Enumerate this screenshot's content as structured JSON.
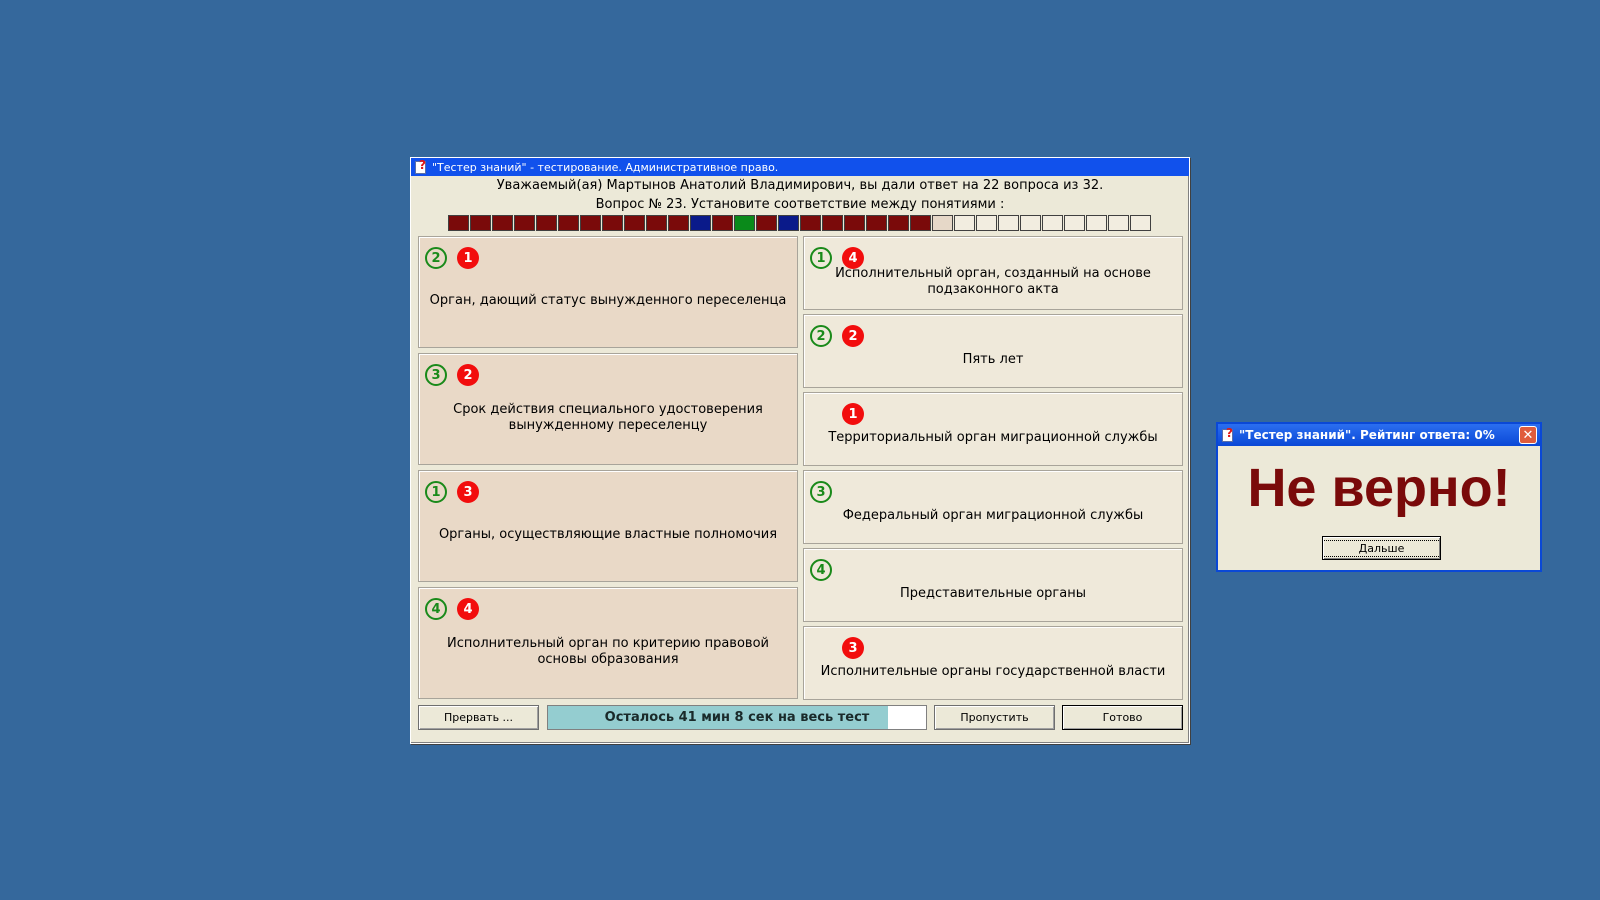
{
  "main_window": {
    "title": "\"Тестер знаний\" - тестирование. Административное право.",
    "greeting": "Уважаемый(ая) Мартынов Анатолий Владимирович, вы дали ответ на 22 вопроса из 32.",
    "question": "Вопрос № 23. Установите соответствие между понятиями :"
  },
  "progress": {
    "total": 32,
    "colors": {
      "wrong": "#7a0a0a",
      "skipped": "#0a1a8a",
      "correct": "#0a8a1a",
      "unanswered": "#f2ede0",
      "current": "#e6d8c8"
    },
    "cells": [
      "wrong",
      "wrong",
      "wrong",
      "wrong",
      "wrong",
      "wrong",
      "wrong",
      "wrong",
      "wrong",
      "wrong",
      "wrong",
      "skipped",
      "wrong",
      "correct",
      "wrong",
      "skipped",
      "wrong",
      "wrong",
      "wrong",
      "wrong",
      "wrong",
      "wrong",
      "current",
      "unanswered",
      "unanswered",
      "unanswered",
      "unanswered",
      "unanswered",
      "unanswered",
      "unanswered",
      "unanswered",
      "unanswered"
    ]
  },
  "left_items": [
    {
      "text": "Орган, дающий статус вынужденного переселенца",
      "green": "2",
      "red": "1"
    },
    {
      "text": "Срок действия специального удостоверения вынужденному переселенцу",
      "green": "3",
      "red": "2"
    },
    {
      "text": "Органы, осуществляющие властные полномочия",
      "green": "1",
      "red": "3"
    },
    {
      "text": "Исполнительный орган по критерию правовой основы образования",
      "green": "4",
      "red": "4"
    }
  ],
  "right_items": [
    {
      "text": "Исполнительный орган, созданный на основе подзаконного акта",
      "green": "1",
      "red": "4"
    },
    {
      "text": "Пять лет",
      "green": "2",
      "red": "2"
    },
    {
      "text": "Территориальный орган миграционной службы",
      "green": "",
      "red": "1"
    },
    {
      "text": "Федеральный орган миграционной службы",
      "green": "3",
      "red": ""
    },
    {
      "text": "Представительные органы",
      "green": "4",
      "red": ""
    },
    {
      "text": "Исполнительные органы государственной власти",
      "green": "",
      "red": "3"
    }
  ],
  "buttons": {
    "abort": "Прервать ...",
    "skip": "Пропустить",
    "done": "Готово"
  },
  "timer": {
    "text": "Осталось 41 мин 8 сек на весь тест",
    "remaining_fraction": 0.9
  },
  "dialog": {
    "title": "\"Тестер знаний\". Рейтинг ответа: 0%",
    "verdict": "Не верно!",
    "next_button": "Дальше",
    "close_glyph": "✕"
  }
}
